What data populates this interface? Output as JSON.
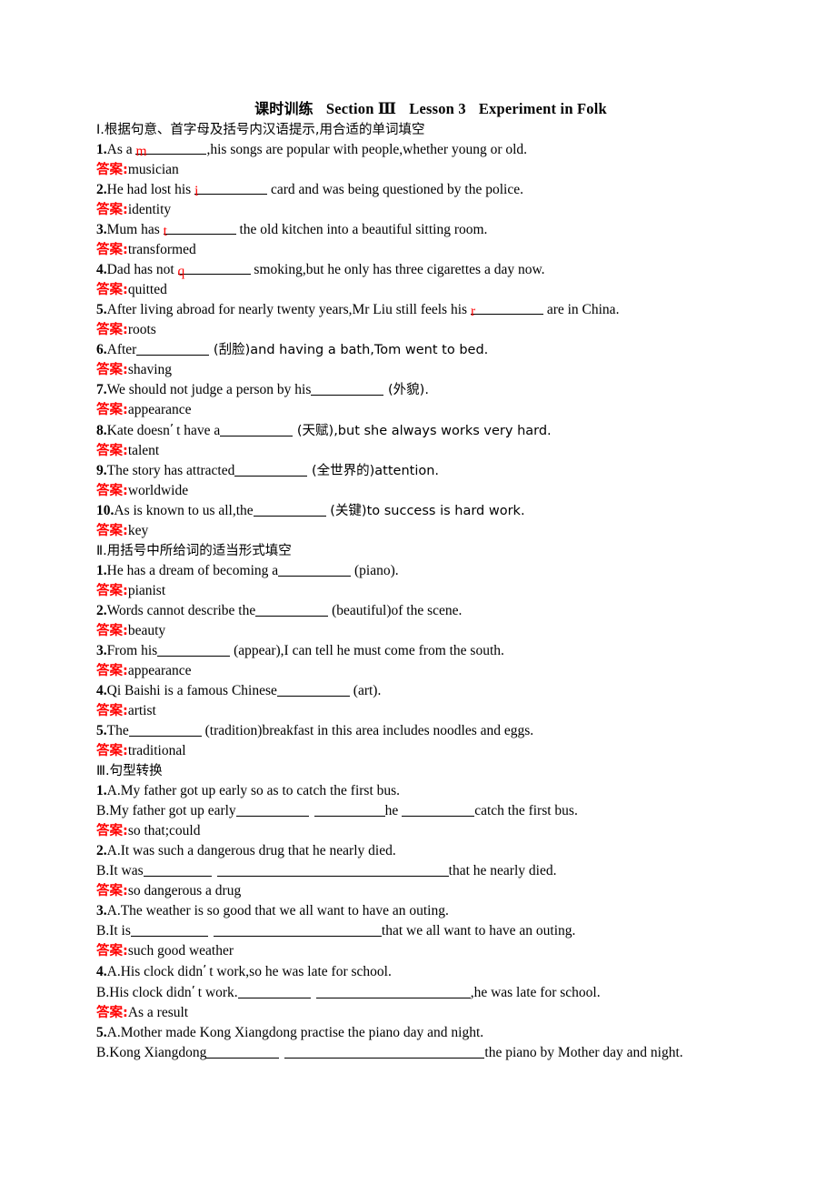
{
  "title": {
    "cjk": "课时训练",
    "section": "Section Ⅲ",
    "lesson": "Lesson 3",
    "topic": "Experiment in Folk"
  },
  "colors": {
    "answer_label": "#ff0000",
    "hint_letter": "#ff0000",
    "text": "#000000",
    "background": "#ffffff"
  },
  "answer_label": "答案:",
  "sections": [
    {
      "heading": "Ⅰ.根据句意、首字母及括号内汉语提示,用合适的单词填空",
      "items": [
        {
          "num": "1.",
          "before": "As a ",
          "hint": "m",
          "after": ",his songs are popular with people,whether young or old.",
          "answer": "musician"
        },
        {
          "num": "2.",
          "before": "He had lost his ",
          "hint": "i",
          "after": " card and was being questioned by the police.",
          "answer": "identity"
        },
        {
          "num": "3.",
          "before": "Mum has ",
          "hint": "t",
          "after": " the old kitchen into a beautiful sitting room.",
          "answer": "transformed"
        },
        {
          "num": "4.",
          "before": "Dad has not ",
          "hint": "q",
          "after": " smoking,but he only has three cigarettes a day now.",
          "answer": "quitted"
        },
        {
          "num": "5.",
          "before": "After living abroad for nearly twenty years,Mr Liu still feels his ",
          "hint": "r",
          "after": " are in China.",
          "answer": "roots"
        },
        {
          "num": "6.",
          "before": "After",
          "hint": "",
          "after": " (刮脸)and having a bath,Tom went to bed.",
          "answer": "shaving"
        },
        {
          "num": "7.",
          "before": "We should not judge a person by his",
          "hint": "",
          "after": " (外貌).",
          "answer": "appearance"
        },
        {
          "num": "8.",
          "before": "Kate doesn’t have a",
          "hint": "",
          "after": " (天赋),but she always works very hard.",
          "answer": "talent"
        },
        {
          "num": "9.",
          "before": "The story has attracted",
          "hint": "",
          "after": " (全世界的)attention.",
          "answer": "worldwide"
        },
        {
          "num": "10.",
          "before": "As is known to us all,the",
          "hint": "",
          "after": " (关键)to success is hard work.",
          "answer": "key"
        }
      ]
    },
    {
      "heading": "Ⅱ.用括号中所给词的适当形式填空",
      "items": [
        {
          "num": "1.",
          "before": "He has a dream of becoming a",
          "after": " (piano).",
          "answer": "pianist"
        },
        {
          "num": "2.",
          "before": "Words cannot describe the",
          "after": " (beautiful)of the scene.",
          "answer": "beauty"
        },
        {
          "num": "3.",
          "before": "From his",
          "after": " (appear),I can tell he must come from the south.",
          "answer": "appearance"
        },
        {
          "num": "4.",
          "before": "Qi Baishi is a famous Chinese",
          "after": " (art).",
          "answer": "artist"
        },
        {
          "num": "5.",
          "before": "The",
          "after": " (tradition)breakfast in this area includes noodles and eggs.",
          "answer": "traditional"
        }
      ]
    },
    {
      "heading": "Ⅲ.句型转换",
      "items": [
        {
          "num": "1.",
          "line_a": "A.My father got up early so as to catch the first bus.",
          "b_before": "B.My father got up early",
          "b_mid": "he ",
          "b_after": "catch the first bus.",
          "answer": "so that;could"
        },
        {
          "num": "2.",
          "line_a": "A.It was such a dangerous drug that he nearly died.",
          "b_before": "B.It was",
          "b_mid": "",
          "b_after": "that he nearly died.",
          "answer": "so dangerous a drug"
        },
        {
          "num": "3.",
          "line_a": "A.The weather is so good that we all want to have an outing.",
          "b_before": "B.It is",
          "b_mid": "",
          "b_after": "that we all want to have an outing.",
          "answer": "such good weather"
        },
        {
          "num": "4.",
          "line_a": "A.His clock didn’t work,so he was late for school.",
          "b_before": "B.His clock didn’t work.",
          "b_mid": "",
          "b_after": ",he was late for school.",
          "answer": "As a result"
        },
        {
          "num": "5.",
          "line_a": "A.Mother made Kong Xiangdong practise the piano day and night.",
          "b_before": "B.Kong Xiangdong",
          "b_mid": "",
          "b_after": "the piano by Mother day and night.",
          "answer": ""
        }
      ]
    }
  ]
}
